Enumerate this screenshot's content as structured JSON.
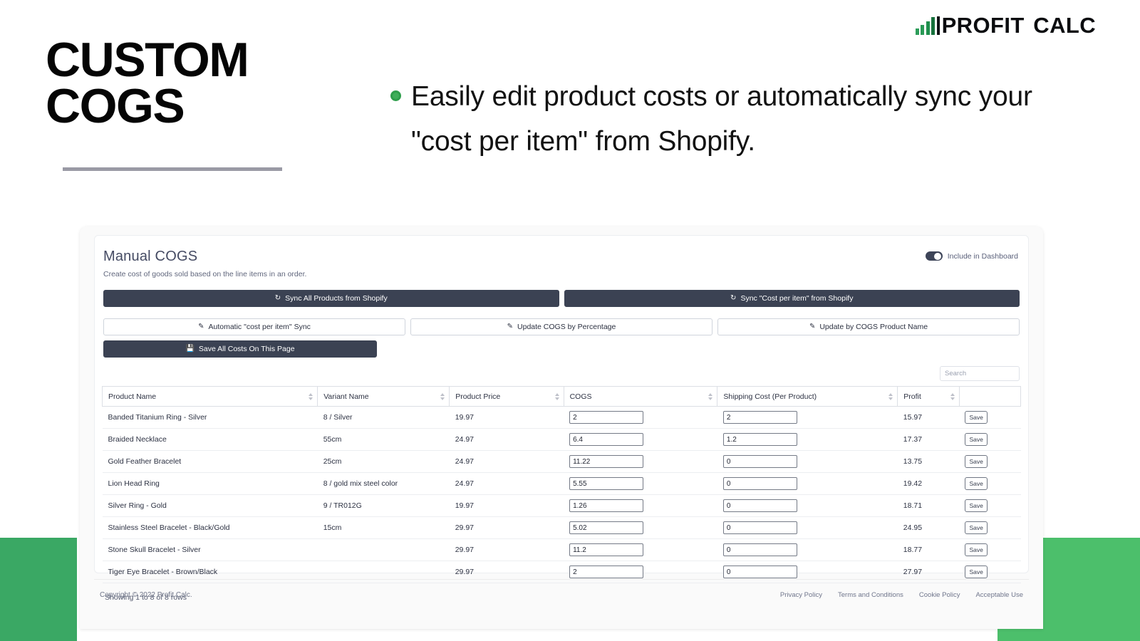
{
  "brand": {
    "name_primary": "PROFIT",
    "name_secondary": "CALC",
    "logo_icon": "bar-chart-logo",
    "accent_green": "#1f9b54"
  },
  "hero": {
    "title_line1": "CUSTOM",
    "title_line2": "COGS",
    "bullet_icon": "green-dot",
    "bullet_text": "Easily edit product costs or automatically sync your \"cost per item\" from Shopify."
  },
  "app": {
    "panel_title": "Manual COGS",
    "panel_subtitle": "Create cost of goods sold based on the line items in an order.",
    "toggle": {
      "label": "Include in Dashboard",
      "state": "on"
    },
    "actions": {
      "sync_all_products": "Sync All Products from Shopify",
      "sync_cost_per_item": "Sync \"Cost per item\" from Shopify",
      "automatic_cost_per_item_sync": "Automatic \"cost per item\" Sync",
      "update_cogs_by_percentage": "Update COGS by Percentage",
      "update_by_cogs_product_name": "Update by COGS Product Name",
      "save_all_costs": "Save All Costs On This Page",
      "sync_icon": "refresh-icon",
      "edit_icon": "pencil-square-icon",
      "save_icon": "floppy-disk-icon"
    },
    "search": {
      "placeholder": "Search",
      "value": ""
    },
    "table": {
      "columns": [
        "Product Name",
        "Variant Name",
        "Product Price",
        "COGS",
        "Shipping Cost (Per Product)",
        "Profit",
        ""
      ],
      "rows": [
        {
          "product_name": "Banded Titanium Ring - Silver",
          "variant_name": "8 / Silver",
          "product_price": "19.97",
          "cogs": "2",
          "shipping_cost": "2",
          "profit": "15.97",
          "save_label": "Save"
        },
        {
          "product_name": "Braided Necklace",
          "variant_name": "55cm",
          "product_price": "24.97",
          "cogs": "6.4",
          "shipping_cost": "1.2",
          "profit": "17.37",
          "save_label": "Save"
        },
        {
          "product_name": "Gold Feather Bracelet",
          "variant_name": "25cm",
          "product_price": "24.97",
          "cogs": "11.22",
          "shipping_cost": "0",
          "profit": "13.75",
          "save_label": "Save"
        },
        {
          "product_name": "Lion Head Ring",
          "variant_name": "8 / gold mix steel color",
          "product_price": "24.97",
          "cogs": "5.55",
          "shipping_cost": "0",
          "profit": "19.42",
          "save_label": "Save"
        },
        {
          "product_name": "Silver Ring - Gold",
          "variant_name": "9 / TR012G",
          "product_price": "19.97",
          "cogs": "1.26",
          "shipping_cost": "0",
          "profit": "18.71",
          "save_label": "Save"
        },
        {
          "product_name": "Stainless Steel Bracelet - Black/Gold",
          "variant_name": "15cm",
          "product_price": "29.97",
          "cogs": "5.02",
          "shipping_cost": "0",
          "profit": "24.95",
          "save_label": "Save"
        },
        {
          "product_name": "Stone Skull Bracelet - Silver",
          "variant_name": "",
          "product_price": "29.97",
          "cogs": "11.2",
          "shipping_cost": "0",
          "profit": "18.77",
          "save_label": "Save"
        },
        {
          "product_name": "Tiger Eye Bracelet - Brown/Black",
          "variant_name": "",
          "product_price": "29.97",
          "cogs": "2",
          "shipping_cost": "0",
          "profit": "27.97",
          "save_label": "Save"
        }
      ],
      "showing_text": "Showing 1 to 8 of 8 rows"
    },
    "footer": {
      "copyright": "Copyright © 2022 Profit Calc.",
      "links": [
        "Privacy Policy",
        "Terms and Conditions",
        "Cookie Policy",
        "Acceptable Use"
      ]
    }
  }
}
